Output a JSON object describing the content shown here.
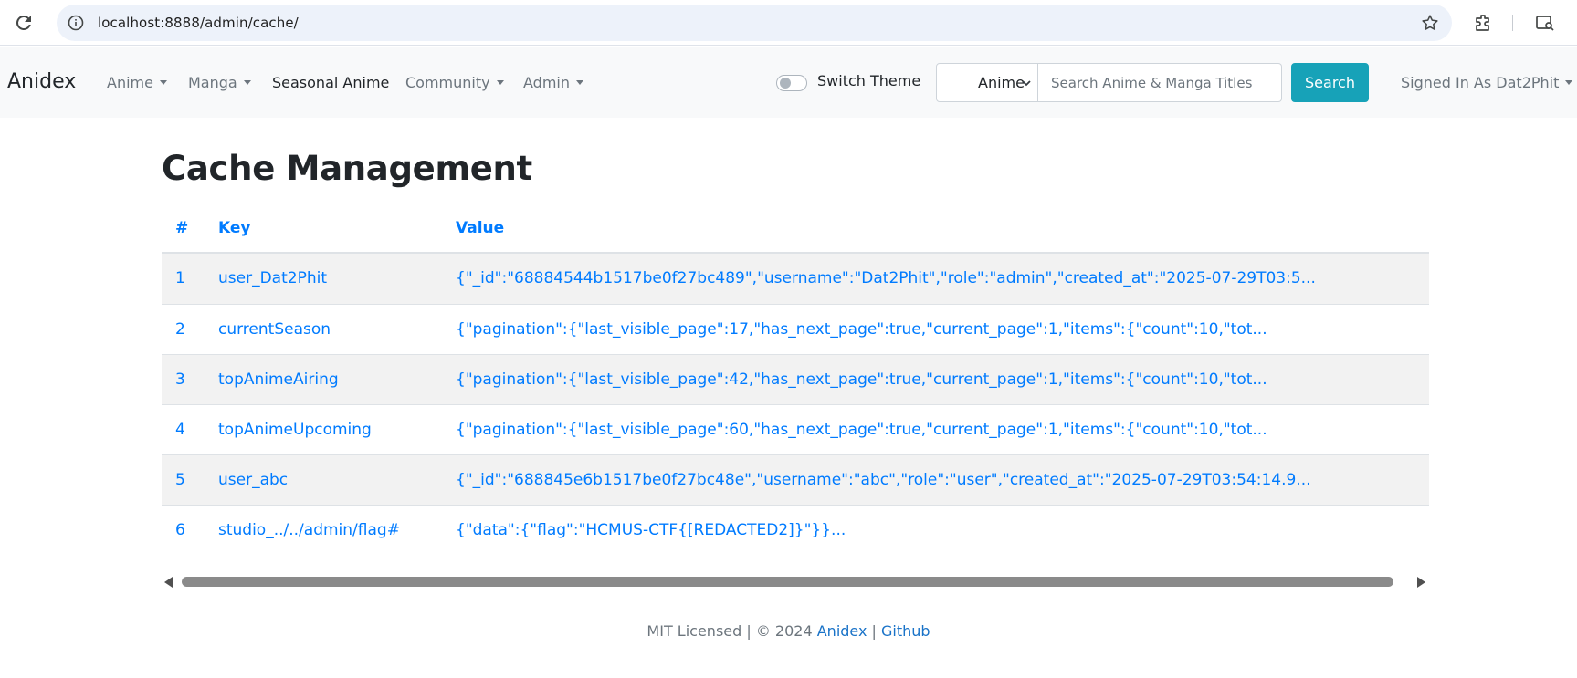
{
  "browser": {
    "url": "localhost:8888/admin/cache/"
  },
  "navbar": {
    "brand": "Anidex",
    "links": [
      {
        "label": "Anime"
      },
      {
        "label": "Manga"
      },
      {
        "label": "Seasonal Anime"
      },
      {
        "label": "Community"
      },
      {
        "label": "Admin"
      }
    ],
    "theme_label": "Switch Theme",
    "theme_on": false,
    "search": {
      "type_value": "Anime",
      "placeholder": "Search Anime & Manga Titles",
      "button_label": "Search"
    },
    "user_label": "Signed In As Dat2Phit"
  },
  "page": {
    "title": "Cache Management"
  },
  "table": {
    "headers": [
      "#",
      "Key",
      "Value"
    ],
    "rows": [
      {
        "num": "1",
        "key": "user_Dat2Phit",
        "value": "{\"_id\":\"68884544b1517be0f27bc489\",\"username\":\"Dat2Phit\",\"role\":\"admin\",\"created_at\":\"2025-07-29T03:5..."
      },
      {
        "num": "2",
        "key": "currentSeason",
        "value": "{\"pagination\":{\"last_visible_page\":17,\"has_next_page\":true,\"current_page\":1,\"items\":{\"count\":10,\"tot..."
      },
      {
        "num": "3",
        "key": "topAnimeAiring",
        "value": "{\"pagination\":{\"last_visible_page\":42,\"has_next_page\":true,\"current_page\":1,\"items\":{\"count\":10,\"tot..."
      },
      {
        "num": "4",
        "key": "topAnimeUpcoming",
        "value": "{\"pagination\":{\"last_visible_page\":60,\"has_next_page\":true,\"current_page\":1,\"items\":{\"count\":10,\"tot..."
      },
      {
        "num": "5",
        "key": "user_abc",
        "value": "{\"_id\":\"688845e6b1517be0f27bc48e\",\"username\":\"abc\",\"role\":\"user\",\"created_at\":\"2025-07-29T03:54:14.9..."
      },
      {
        "num": "6",
        "key": "studio_../../admin/flag#",
        "value": "{\"data\":{\"flag\":\"HCMUS-CTF{[REDACTED2]}\"}}..."
      }
    ]
  },
  "footer": {
    "license": "MIT Licensed | © 2024 ",
    "anidex_link": "Anidex",
    "separator": " | ",
    "github_link": "Github"
  },
  "colors": {
    "link": "#007bff",
    "accent_button": "#17a2b8",
    "navbar_bg": "#f8f9fa",
    "stripe": "#f2f2f2"
  }
}
